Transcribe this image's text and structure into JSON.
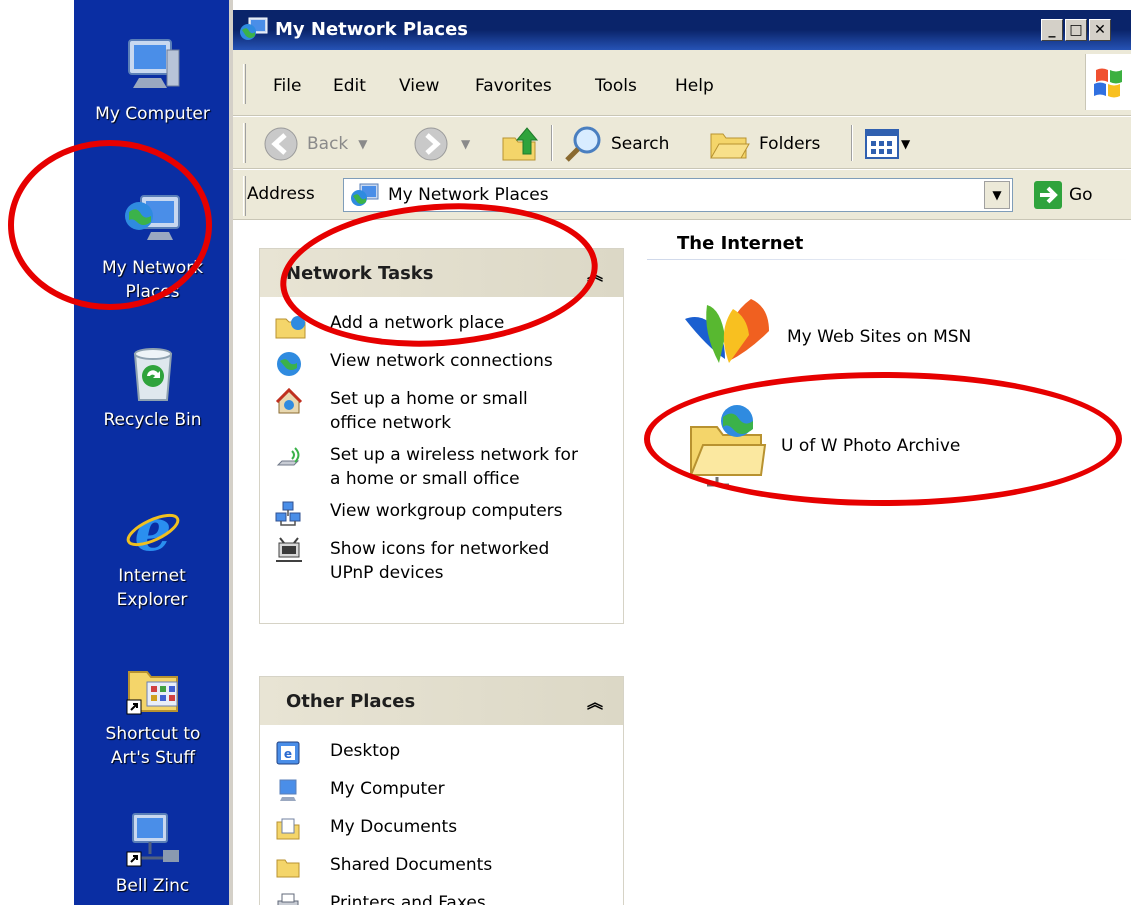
{
  "desktop": {
    "items": [
      {
        "label": "My Computer",
        "icon": "my-computer-icon"
      },
      {
        "label": "My Network Places",
        "icon": "network-places-icon"
      },
      {
        "label": "Recycle Bin",
        "icon": "recycle-bin-icon"
      },
      {
        "label": "Internet Explorer",
        "icon": "internet-explorer-icon"
      },
      {
        "label": "Shortcut to Art's Stuff",
        "icon": "shortcut-folder-icon"
      },
      {
        "label": "Bell Zinc",
        "icon": "network-computer-icon"
      }
    ],
    "background": "#0a2ea3"
  },
  "window": {
    "title": "My Network Places",
    "menu": [
      "File",
      "Edit",
      "View",
      "Favorites",
      "Tools",
      "Help"
    ],
    "toolbar": {
      "back": "Back",
      "search": "Search",
      "folders": "Folders"
    },
    "address": {
      "label": "Address",
      "value": "My Network Places",
      "go": "Go"
    }
  },
  "tasks": {
    "network_tasks": {
      "title": "Network Tasks",
      "items": [
        "Add a network place",
        "View network connections",
        "Set up a home or small office network",
        "Set up a wireless network for a home or small office",
        "View workgroup computers",
        "Show icons for networked UPnP devices"
      ]
    },
    "other_places": {
      "title": "Other Places",
      "items": [
        "Desktop",
        "My Computer",
        "My Documents",
        "Shared Documents",
        "Printers and Faxes"
      ]
    }
  },
  "content": {
    "group": "The Internet",
    "items": [
      "My Web Sites on MSN",
      "U of W Photo Archive"
    ]
  },
  "annotation_color": "#e60000"
}
